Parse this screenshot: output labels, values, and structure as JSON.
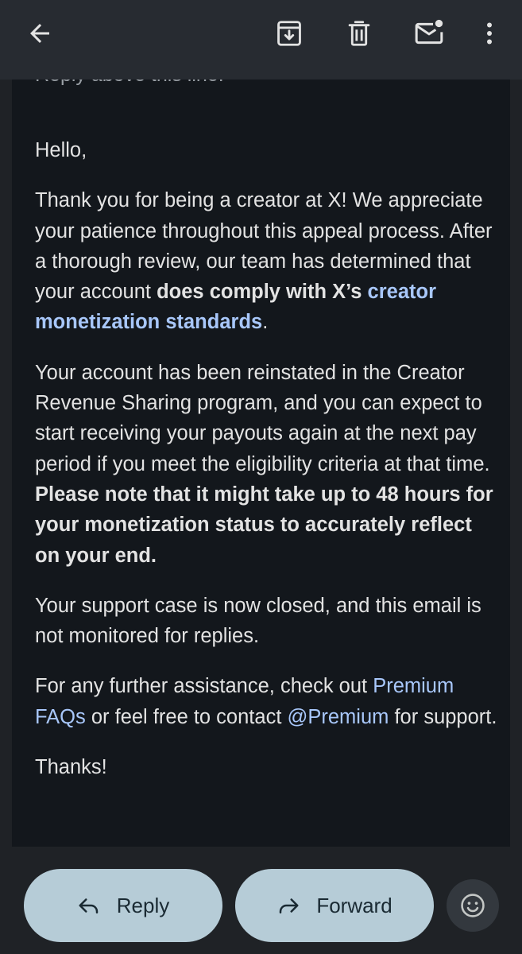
{
  "toolbar": {
    "back_icon": "arrow-left-icon",
    "archive_icon": "archive-icon",
    "delete_icon": "trash-icon",
    "unread_icon": "mark-unread-icon",
    "more_icon": "more-vert-icon"
  },
  "email": {
    "clipped_header": "Reply above this line.",
    "greeting": "Hello,",
    "p1_a": "Thank you for being a creator at X! We appreciate your patience throughout this appeal process. After a thorough review, our team has determined that your account ",
    "p1_bold": "does comply with X’s ",
    "p1_link": "creator monetization standards",
    "p1_end": ".",
    "p2_a": "Your account has been reinstated in the Creator Revenue Sharing program, and you can expect to start receiving your payouts again at the next pay period if you meet the eligibility criteria at that time. ",
    "p2_bold": "Please note that it might take up to 48 hours for your monetization status to accurately reflect on your end.",
    "p3": "Your support case is now closed, and this email is not monitored for replies.",
    "p4_a": "For any further assistance, check out ",
    "p4_link1": "Premium FAQs",
    "p4_b": " or feel free to contact ",
    "p4_link2": "@Premium",
    "p4_c": " for support.",
    "signoff": "Thanks!"
  },
  "actions": {
    "reply_label": "Reply",
    "forward_label": "Forward",
    "reply_icon": "reply-icon",
    "forward_icon": "forward-icon",
    "emoji_icon": "emoji-smile-icon"
  },
  "colors": {
    "topbar_bg": "#272b31",
    "card_bg": "#13171c",
    "text": "#e3e3e3",
    "link": "#a8c7fa",
    "pill_bg": "#b6ccd7"
  }
}
